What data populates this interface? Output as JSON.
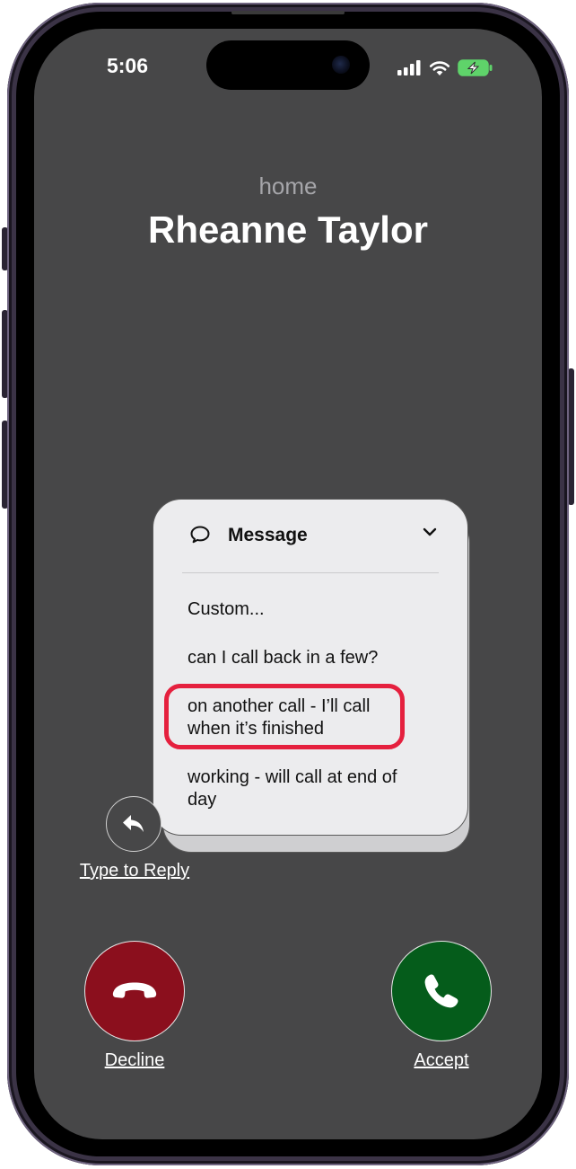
{
  "status_bar": {
    "time": "5:06",
    "icons": [
      "cellular-signal-icon",
      "wifi-icon",
      "battery-charging-icon"
    ]
  },
  "caller": {
    "label": "home",
    "name": "Rheanne Taylor"
  },
  "message_menu": {
    "title": "Message",
    "icon": "message-bubble-icon",
    "collapse_icon": "chevron-down-icon",
    "items": [
      {
        "text": "Custom..."
      },
      {
        "text": "can I call back in a few?"
      },
      {
        "text": "on another call - I’ll call when it’s finished",
        "highlighted": true
      },
      {
        "text": "working - will call at end of day"
      }
    ],
    "highlight_color": "#e5203e"
  },
  "reply": {
    "icon": "reply-arrow-icon",
    "label": "Type to Reply"
  },
  "actions": {
    "decline_label": "Decline",
    "decline_color": "#8b0f1d",
    "accept_label": "Accept",
    "accept_color": "#055c1b"
  }
}
